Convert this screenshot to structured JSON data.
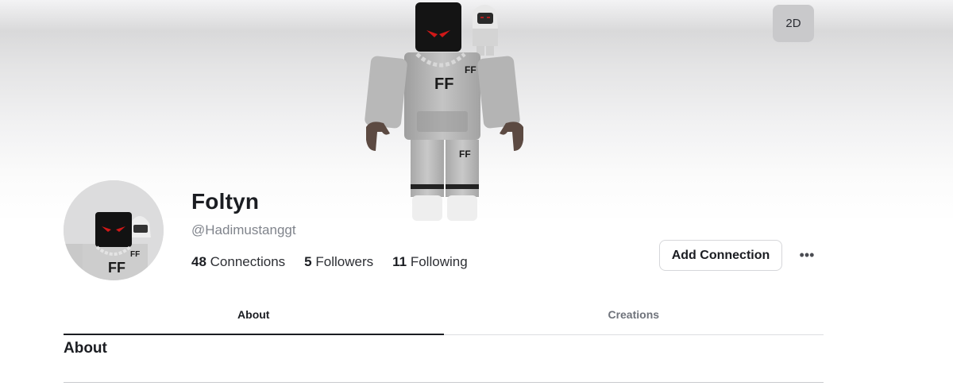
{
  "banner": {
    "view_toggle_label": "2D"
  },
  "profile": {
    "display_name": "Foltyn",
    "username": "@Hadimustanggt",
    "stats": {
      "connections_count": "48",
      "connections_label": "Connections",
      "followers_count": "5",
      "followers_label": "Followers",
      "following_count": "11",
      "following_label": "Following"
    },
    "add_connection_label": "Add Connection",
    "more_options_glyph": "•••"
  },
  "avatar": {
    "shirt_text": "FF"
  },
  "tabs": [
    {
      "label": "About",
      "active": true
    },
    {
      "label": "Creations",
      "active": false
    }
  ],
  "about": {
    "heading": "About"
  }
}
